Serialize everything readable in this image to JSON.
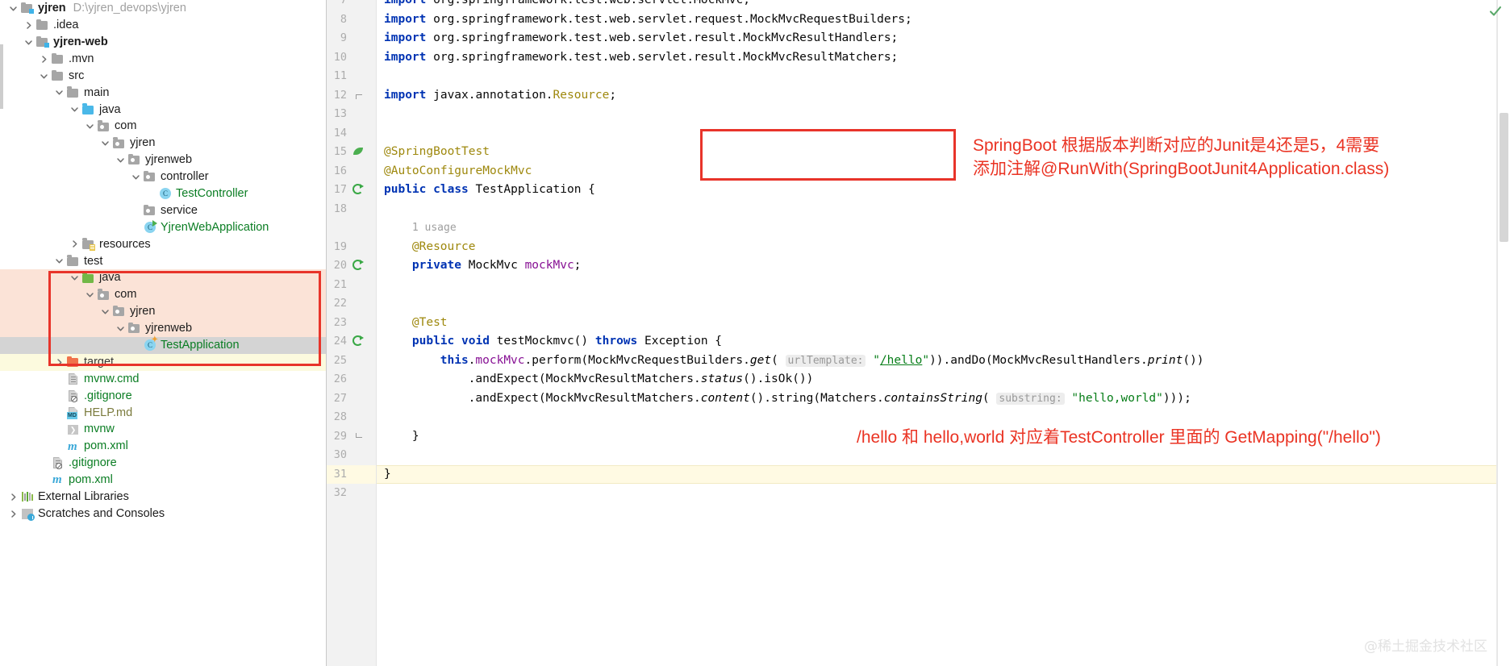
{
  "project_tree": {
    "rows": [
      {
        "label": "yjren",
        "path": "D:\\yjren_devops\\yjren",
        "icon": "module-folder-icon",
        "arrow": "expanded",
        "indent": 0,
        "style": "bold",
        "state": "none"
      },
      {
        "label": ".idea",
        "path": "",
        "icon": "folder-icon",
        "arrow": "collapsed",
        "indent": 1,
        "style": "plain-dark",
        "state": "none"
      },
      {
        "label": "yjren-web",
        "path": "",
        "icon": "module-folder-icon",
        "arrow": "expanded",
        "indent": 1,
        "style": "bold",
        "state": "none"
      },
      {
        "label": ".mvn",
        "path": "",
        "icon": "folder-icon",
        "arrow": "collapsed",
        "indent": 2,
        "style": "plain-dark",
        "state": "none"
      },
      {
        "label": "src",
        "path": "",
        "icon": "folder-icon",
        "arrow": "expanded",
        "indent": 2,
        "style": "plain-dark",
        "state": "none"
      },
      {
        "label": "main",
        "path": "",
        "icon": "folder-icon",
        "arrow": "expanded",
        "indent": 3,
        "style": "plain-dark",
        "state": "none"
      },
      {
        "label": "java",
        "path": "",
        "icon": "source-root-folder-icon",
        "arrow": "expanded",
        "indent": 4,
        "style": "plain-dark",
        "state": "none"
      },
      {
        "label": "com",
        "path": "",
        "icon": "package-icon",
        "arrow": "expanded",
        "indent": 5,
        "style": "plain-dark",
        "state": "none"
      },
      {
        "label": "yjren",
        "path": "",
        "icon": "package-icon",
        "arrow": "expanded",
        "indent": 6,
        "style": "plain-dark",
        "state": "none"
      },
      {
        "label": "yjrenweb",
        "path": "",
        "icon": "package-icon",
        "arrow": "expanded",
        "indent": 7,
        "style": "plain-dark",
        "state": "none"
      },
      {
        "label": "controller",
        "path": "",
        "icon": "package-icon",
        "arrow": "expanded",
        "indent": 8,
        "style": "plain-dark",
        "state": "none"
      },
      {
        "label": "TestController",
        "path": "",
        "icon": "java-class-icon",
        "arrow": "none",
        "indent": 9,
        "style": "green",
        "state": "none"
      },
      {
        "label": "service",
        "path": "",
        "icon": "package-icon",
        "arrow": "none",
        "indent": 8,
        "style": "plain-dark",
        "state": "none"
      },
      {
        "label": "YjrenWebApplication",
        "path": "",
        "icon": "runnable-class-icon",
        "arrow": "none",
        "indent": 8,
        "style": "green",
        "state": "none"
      },
      {
        "label": "resources",
        "path": "",
        "icon": "resources-folder-icon",
        "arrow": "collapsed",
        "indent": 4,
        "style": "plain-dark",
        "state": "none"
      },
      {
        "label": "test",
        "path": "",
        "icon": "folder-icon",
        "arrow": "expanded",
        "indent": 3,
        "style": "plain-dark",
        "state": "none"
      },
      {
        "label": "java",
        "path": "",
        "icon": "test-source-root-folder-icon",
        "arrow": "expanded",
        "indent": 4,
        "style": "plain-dark",
        "state": "peach"
      },
      {
        "label": "com",
        "path": "",
        "icon": "package-icon",
        "arrow": "expanded",
        "indent": 5,
        "style": "plain-dark",
        "state": "peach"
      },
      {
        "label": "yjren",
        "path": "",
        "icon": "package-icon",
        "arrow": "expanded",
        "indent": 6,
        "style": "plain-dark",
        "state": "peach"
      },
      {
        "label": "yjrenweb",
        "path": "",
        "icon": "package-icon",
        "arrow": "expanded",
        "indent": 7,
        "style": "plain-dark",
        "state": "peach"
      },
      {
        "label": "TestApplication",
        "path": "",
        "icon": "test-class-icon",
        "arrow": "none",
        "indent": 8,
        "style": "green",
        "state": "selected"
      },
      {
        "label": "target",
        "path": "",
        "icon": "excluded-folder-icon",
        "arrow": "collapsed",
        "indent": 3,
        "style": "greydark",
        "state": "yellow"
      },
      {
        "label": "mvnw.cmd",
        "path": "",
        "icon": "file-icon",
        "arrow": "none",
        "indent": 3,
        "style": "green",
        "state": "none"
      },
      {
        "label": ".gitignore",
        "path": "",
        "icon": "gitignore-file-icon",
        "arrow": "none",
        "indent": 3,
        "style": "green",
        "state": "none"
      },
      {
        "label": "HELP.md",
        "path": "",
        "icon": "markdown-file-icon",
        "arrow": "none",
        "indent": 3,
        "style": "olive",
        "state": "none"
      },
      {
        "label": "mvnw",
        "path": "",
        "icon": "script-file-icon",
        "arrow": "none",
        "indent": 3,
        "style": "green",
        "state": "none"
      },
      {
        "label": "pom.xml",
        "path": "",
        "icon": "maven-pom-icon",
        "arrow": "none",
        "indent": 3,
        "style": "green",
        "state": "none"
      },
      {
        "label": ".gitignore",
        "path": "",
        "icon": "gitignore-file-icon",
        "arrow": "none",
        "indent": 2,
        "style": "green",
        "state": "none"
      },
      {
        "label": "pom.xml",
        "path": "",
        "icon": "maven-pom-icon",
        "arrow": "none",
        "indent": 2,
        "style": "green",
        "state": "none"
      },
      {
        "label": "External Libraries",
        "path": "",
        "icon": "external-libraries-icon",
        "arrow": "collapsed",
        "indent": 0,
        "style": "plain-dark",
        "state": "none"
      },
      {
        "label": "Scratches and Consoles",
        "path": "",
        "icon": "scratches-icon",
        "arrow": "collapsed",
        "indent": 0,
        "style": "plain-dark",
        "state": "none"
      }
    ]
  },
  "editor": {
    "lines": [
      {
        "num": "7",
        "gutter_icon": "",
        "indent": 0,
        "segments": [
          {
            "t": "import",
            "c": "kw"
          },
          {
            "t": " org.springframework.test.web.servlet.MockMvc;",
            "c": "plain"
          }
        ]
      },
      {
        "num": "8",
        "gutter_icon": "",
        "indent": 0,
        "segments": [
          {
            "t": "import",
            "c": "kw"
          },
          {
            "t": " org.springframework.test.web.servlet.request.MockMvcRequestBuilders;",
            "c": "plain"
          }
        ]
      },
      {
        "num": "9",
        "gutter_icon": "",
        "indent": 0,
        "segments": [
          {
            "t": "import",
            "c": "kw"
          },
          {
            "t": " org.springframework.test.web.servlet.result.MockMvcResultHandlers;",
            "c": "plain"
          }
        ]
      },
      {
        "num": "10",
        "gutter_icon": "",
        "indent": 0,
        "segments": [
          {
            "t": "import",
            "c": "kw"
          },
          {
            "t": " org.springframework.test.web.servlet.result.MockMvcResultMatchers;",
            "c": "plain"
          }
        ]
      },
      {
        "num": "11",
        "gutter_icon": "",
        "indent": 0,
        "segments": []
      },
      {
        "num": "12",
        "gutter_icon": "fold-top",
        "indent": 0,
        "segments": [
          {
            "t": "import",
            "c": "kw"
          },
          {
            "t": " javax.annotation.",
            "c": "plain"
          },
          {
            "t": "Resource",
            "c": "ann"
          },
          {
            "t": ";",
            "c": "plain"
          }
        ]
      },
      {
        "num": "13",
        "gutter_icon": "",
        "indent": 0,
        "segments": []
      },
      {
        "num": "14",
        "gutter_icon": "",
        "indent": 0,
        "segments": []
      },
      {
        "num": "15",
        "gutter_icon": "leaf",
        "indent": 0,
        "segments": [
          {
            "t": "@SpringBootTest",
            "c": "ann"
          }
        ]
      },
      {
        "num": "16",
        "gutter_icon": "",
        "indent": 0,
        "segments": [
          {
            "t": "@AutoConfigureMockMvc",
            "c": "ann"
          }
        ]
      },
      {
        "num": "17",
        "gutter_icon": "rerun",
        "indent": 0,
        "segments": [
          {
            "t": "public",
            "c": "kw"
          },
          {
            "t": " ",
            "c": "plain"
          },
          {
            "t": "class",
            "c": "kw"
          },
          {
            "t": " TestApplication {",
            "c": "plain"
          }
        ]
      },
      {
        "num": "18",
        "gutter_icon": "",
        "indent": 0,
        "segments": []
      },
      {
        "num": "",
        "gutter_icon": "",
        "indent": 1,
        "segments": [
          {
            "t": "1 usage",
            "c": "usage"
          }
        ]
      },
      {
        "num": "19",
        "gutter_icon": "",
        "indent": 1,
        "segments": [
          {
            "t": "@Resource",
            "c": "ann"
          }
        ]
      },
      {
        "num": "20",
        "gutter_icon": "rerun",
        "indent": 1,
        "segments": [
          {
            "t": "private",
            "c": "kw"
          },
          {
            "t": " MockMvc ",
            "c": "plain"
          },
          {
            "t": "mockMvc",
            "c": "fld"
          },
          {
            "t": ";",
            "c": "plain"
          }
        ]
      },
      {
        "num": "21",
        "gutter_icon": "",
        "indent": 0,
        "segments": []
      },
      {
        "num": "22",
        "gutter_icon": "",
        "indent": 0,
        "segments": []
      },
      {
        "num": "23",
        "gutter_icon": "",
        "indent": 1,
        "segments": [
          {
            "t": "@Test",
            "c": "ann"
          }
        ]
      },
      {
        "num": "24",
        "gutter_icon": "rerun",
        "indent": 1,
        "segments": [
          {
            "t": "public",
            "c": "kw"
          },
          {
            "t": " ",
            "c": "plain"
          },
          {
            "t": "void",
            "c": "kw"
          },
          {
            "t": " testMockmvc() ",
            "c": "plain"
          },
          {
            "t": "throws",
            "c": "kw"
          },
          {
            "t": " Exception {",
            "c": "plain"
          }
        ]
      },
      {
        "num": "25",
        "gutter_icon": "",
        "indent": 2,
        "segments": [
          {
            "t": "this",
            "c": "kw"
          },
          {
            "t": ".",
            "c": "plain"
          },
          {
            "t": "mockMvc",
            "c": "fld"
          },
          {
            "t": ".perform(MockMvcRequestBuilders.",
            "c": "plain"
          },
          {
            "t": "get",
            "c": "mth"
          },
          {
            "t": "( ",
            "c": "plain"
          },
          {
            "t": "urlTemplate:",
            "c": "hint"
          },
          {
            "t": " ",
            "c": "plain"
          },
          {
            "t": "\"/hello\"",
            "c": "url"
          },
          {
            "t": ")).andDo(MockMvcResultHandlers.",
            "c": "plain"
          },
          {
            "t": "print",
            "c": "mth"
          },
          {
            "t": "())",
            "c": "plain"
          }
        ]
      },
      {
        "num": "26",
        "gutter_icon": "",
        "indent": 3,
        "segments": [
          {
            "t": ".andExpect(MockMvcResultMatchers.",
            "c": "plain"
          },
          {
            "t": "status",
            "c": "mth"
          },
          {
            "t": "().isOk())",
            "c": "plain"
          }
        ]
      },
      {
        "num": "27",
        "gutter_icon": "",
        "indent": 3,
        "segments": [
          {
            "t": ".andExpect(MockMvcResultMatchers.",
            "c": "plain"
          },
          {
            "t": "content",
            "c": "mth"
          },
          {
            "t": "().string(Matchers.",
            "c": "plain"
          },
          {
            "t": "containsString",
            "c": "mth"
          },
          {
            "t": "( ",
            "c": "plain"
          },
          {
            "t": "substring:",
            "c": "hint"
          },
          {
            "t": " ",
            "c": "plain"
          },
          {
            "t": "\"hello,world\"",
            "c": "str"
          },
          {
            "t": ")));",
            "c": "plain"
          }
        ]
      },
      {
        "num": "28",
        "gutter_icon": "",
        "indent": 0,
        "segments": []
      },
      {
        "num": "29",
        "gutter_icon": "fold-bottom",
        "indent": 1,
        "segments": [
          {
            "t": "}",
            "c": "plain"
          }
        ]
      },
      {
        "num": "30",
        "gutter_icon": "",
        "indent": 0,
        "segments": []
      },
      {
        "num": "31",
        "gutter_icon": "",
        "indent": 0,
        "segments": [
          {
            "t": "}",
            "c": "plain"
          }
        ]
      },
      {
        "num": "32",
        "gutter_icon": "",
        "indent": 0,
        "segments": []
      }
    ],
    "current_line_number": "31"
  },
  "annotations": {
    "note_top_line1": "SpringBoot 根据版本判断对应的Junit是4还是5，4需要",
    "note_top_line2": "添加注解@RunWith(SpringBootJunit4Application.class)",
    "note_bottom": "/hello 和 hello,world 对应着TestController 里面的 GetMapping(\"/hello\")",
    "color": "#ea3323"
  },
  "status": {
    "inspection_icon": "checkmark-ok-icon",
    "inspection_color": "#59a869"
  },
  "watermark": {
    "text": "@稀土掘金技术社区"
  }
}
